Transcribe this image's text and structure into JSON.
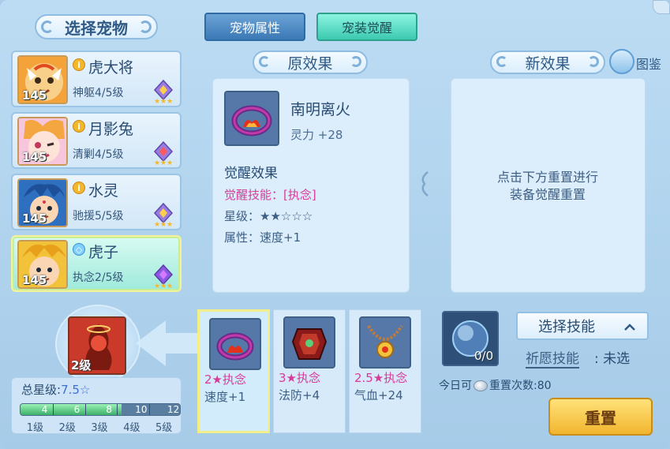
{
  "left": {
    "title": "选择宠物",
    "pets": [
      {
        "name": "虎大将",
        "level": "145",
        "stat": "神躯4/5级",
        "badge": "i"
      },
      {
        "name": "月影兔",
        "level": "145",
        "stat": "清剿4/5级",
        "badge": "i"
      },
      {
        "name": "水灵",
        "level": "145",
        "stat": "驰援5/5级",
        "badge": "i"
      },
      {
        "name": "虎子",
        "level": "145",
        "stat": "执念2/5级",
        "badge": "◇"
      }
    ],
    "awaken_level": "2级",
    "star_summary": {
      "label": "总星级:",
      "value": "7.5☆",
      "progress_ticks": [
        "4",
        "6",
        "8",
        "10",
        "12"
      ],
      "progress_value": 7.5,
      "progress_max": 12,
      "level_labels": [
        "1级",
        "2级",
        "3级",
        "4级",
        "5级"
      ]
    }
  },
  "tabs": {
    "pet_attr": "宠物属性",
    "awaken": "宠装觉醒"
  },
  "original": {
    "title": "原效果",
    "equip_name": "南明离火",
    "equip_attr": "灵力 +28",
    "awaken_head": "觉醒效果",
    "skill_label": "觉醒技能：",
    "skill_value": "[执念]",
    "star_label": "星级：",
    "star_value": "★★☆☆☆",
    "attr_label": "属性：",
    "attr_value": "速度+1"
  },
  "new_effect": {
    "title": "新效果",
    "manual_label": "图鉴",
    "hint_line1": "点击下方重置进行",
    "hint_line2": "装备觉醒重置"
  },
  "options": [
    {
      "skill": "2★执念",
      "attr": "速度+1"
    },
    {
      "skill": "3★执念",
      "attr": "法防+4"
    },
    {
      "skill": "2.5★执念",
      "attr": "气血+24"
    }
  ],
  "reset_panel": {
    "orb_count": "0/0",
    "choose_skill": "选择技能",
    "wish_label": "祈愿技能",
    "wish_value": ": 未选",
    "today_prefix": "今日可",
    "today_suffix": "重置次数:80",
    "reset_button": "重置"
  },
  "colors": {
    "accent_pink": "#d93a9a",
    "tab_active": "#3cc9b1",
    "tab_inactive": "#3b79b6",
    "reset_button": "#f1b52e"
  }
}
